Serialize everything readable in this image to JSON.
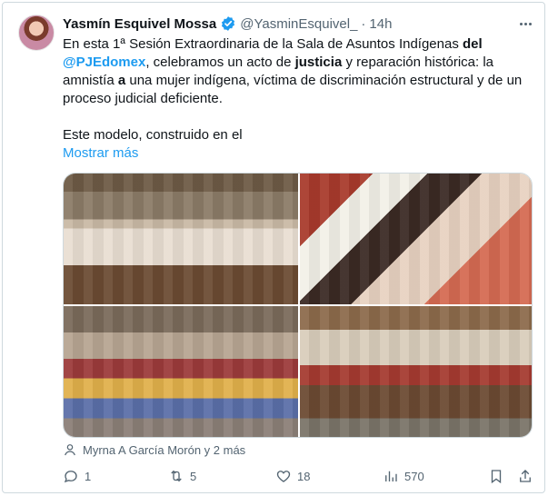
{
  "tweet": {
    "author_name": "Yasmín Esquivel Mossa",
    "handle": "@YasminEsquivel_",
    "dot": "·",
    "time": "14h",
    "text": {
      "p1_a": "En esta 1ª Sesión Extraordinaria de la Sala de Asuntos Indígenas ",
      "p1_b": "del",
      "p1_c": " ",
      "p1_link": "@PJEdomex",
      "p1_d": ", celebramos un acto de ",
      "p1_e": "justicia",
      "p1_f": " y reparación histórica: la amnistía ",
      "p1_g": "a",
      "p1_h": " una mujer indígena, víctima de discriminación estructural y de un proceso judicial deficiente.",
      "p2": "Este modelo, construido en el"
    },
    "show_more": "Mostrar más",
    "tagged": "Myrna A García Morón y 2 más",
    "stats": {
      "replies": "1",
      "reposts": "5",
      "likes": "18",
      "views": "570"
    }
  },
  "icons": {
    "verified": "verified-badge-icon",
    "more": "more-horizontal-icon",
    "reply": "reply-icon",
    "repost": "repost-icon",
    "like": "heart-icon",
    "views": "views-chart-icon",
    "bookmark": "bookmark-icon",
    "share": "share-icon",
    "tag": "person-tag-icon"
  },
  "colors": {
    "accent": "#1d9bf0",
    "secondary_text": "#536471",
    "primary_text": "#0f1419",
    "border": "#cfd9de"
  }
}
